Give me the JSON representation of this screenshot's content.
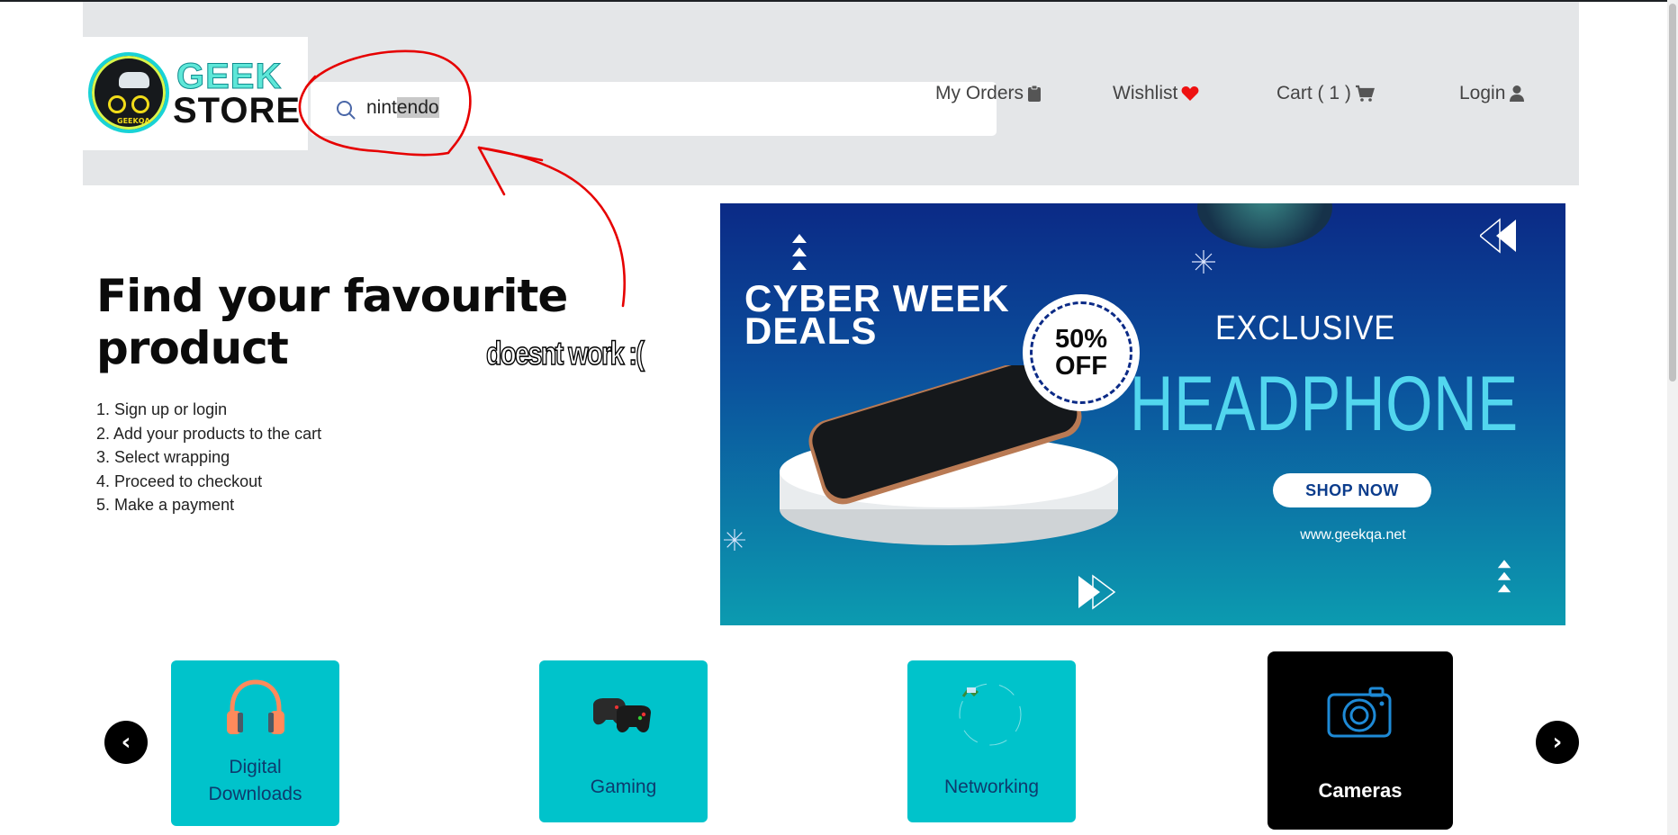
{
  "header": {
    "logo_top": "GEEK",
    "logo_bottom": "STORE",
    "logo_mini": "GEEKQA",
    "search": {
      "typed_prefix": "nint",
      "selected_suffix": "endo"
    },
    "nav": [
      {
        "label": "My Orders",
        "icon": "clipboard-icon"
      },
      {
        "label": "Wishlist",
        "icon": "heart-icon"
      },
      {
        "label": "Cart ( 1 )",
        "icon": "cart-icon"
      },
      {
        "label": "Login",
        "icon": "user-icon"
      }
    ]
  },
  "annotation": {
    "text": "doesnt work :(",
    "color": "#e60000"
  },
  "hero": {
    "title": "Find your favourite product",
    "steps": [
      "1. Sign up or login",
      "2. Add your products to the cart",
      "3. Select wrapping",
      "4. Proceed to checkout",
      "5. Make a payment"
    ]
  },
  "banner": {
    "deal_line1": "CYBER WEEK",
    "deal_line2": "DEALS",
    "badge_line1": "50%",
    "badge_line2": "OFF",
    "exclusive": "EXCLUSIVE",
    "headline": "HEADPHONE",
    "cta": "SHOP NOW",
    "url": "www.geekqa.net"
  },
  "categories": {
    "prev": "‹",
    "next": "›",
    "items": [
      {
        "label_line1": "Digital",
        "label_line2": "Downloads",
        "icon": "headphones-icon"
      },
      {
        "label_line1": "Gaming",
        "label_line2": "",
        "icon": "gamepad-icon"
      },
      {
        "label_line1": "Networking",
        "label_line2": "",
        "icon": "broken-image-icon"
      },
      {
        "label_line1": "Cameras",
        "label_line2": "",
        "icon": "camera-icon",
        "active": true
      }
    ]
  },
  "colors": {
    "teal": "#00c3cb",
    "header_bg": "#e4e6e8",
    "annotation": "#e60000"
  }
}
